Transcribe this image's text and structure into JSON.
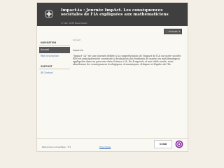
{
  "header": {
    "title": "Impact-ia : Journée ImpAct. Les conséquences sociétales de l'IA expliquées aux mathématiciens",
    "subtitle": "17 déc. 2025 Rosa Ghezzi"
  },
  "language": {
    "label": "Français",
    "caret": "▾"
  },
  "sidebar": {
    "navigation_heading": "NAVIGATION",
    "items": [
      {
        "label": "Accueil"
      },
      {
        "label": "Mon inscription"
      }
    ],
    "support_heading": "SUPPORT",
    "contact_label": "Contact"
  },
  "breadcrumb": "Accueil",
  "content": {
    "heading": "Impact-ia",
    "paragraph": "\"Impact- IA\" est une journée dédiée à la compréhension de l'impact de l'IA sur notre société. Elle est principalement construite à destination des étudiants de master en mathématiques appliquées dans un parcours data Science / IA. En 4 exposés et une table ronde, nous aborderons les conséquences écologiques, économiques, éthiques et légales de l'IA"
  },
  "footer": {
    "online_text": "Personnes connectées : 5",
    "online_caret": "▾",
    "help_label": "Plus d'aide",
    "powered_by": "CCSD"
  },
  "colors": {
    "header_bg": "#3f3f3f",
    "active_nav": "#575757",
    "link": "#3d6fb8",
    "page_bg": "#f3efe6"
  }
}
